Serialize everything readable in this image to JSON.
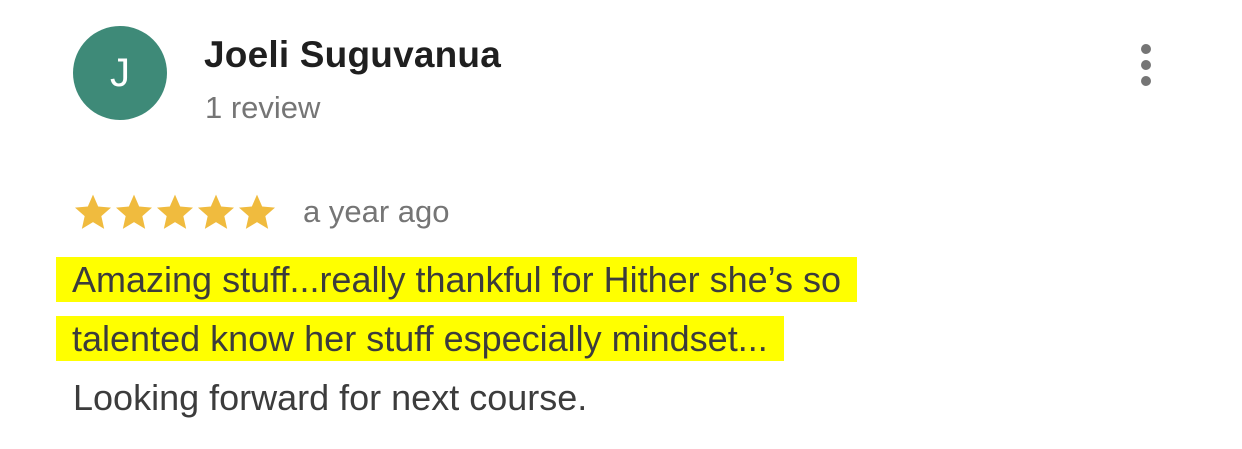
{
  "reviewer": {
    "initial": "J",
    "name": "Joeli Suguvanua",
    "review_count": "1 review",
    "avatar_color": "#3e8a78"
  },
  "menu": {
    "icon": "more-vert-icon"
  },
  "review": {
    "rating": 5,
    "max_rating": 5,
    "star_color": "#f0bb3e",
    "time": "a year ago",
    "highlight_color": "#ffff00",
    "lines": [
      "Amazing stuff...really thankful for Hither she’s so",
      "talented know her stuff especially mindset...",
      "Looking forward for next course."
    ]
  }
}
